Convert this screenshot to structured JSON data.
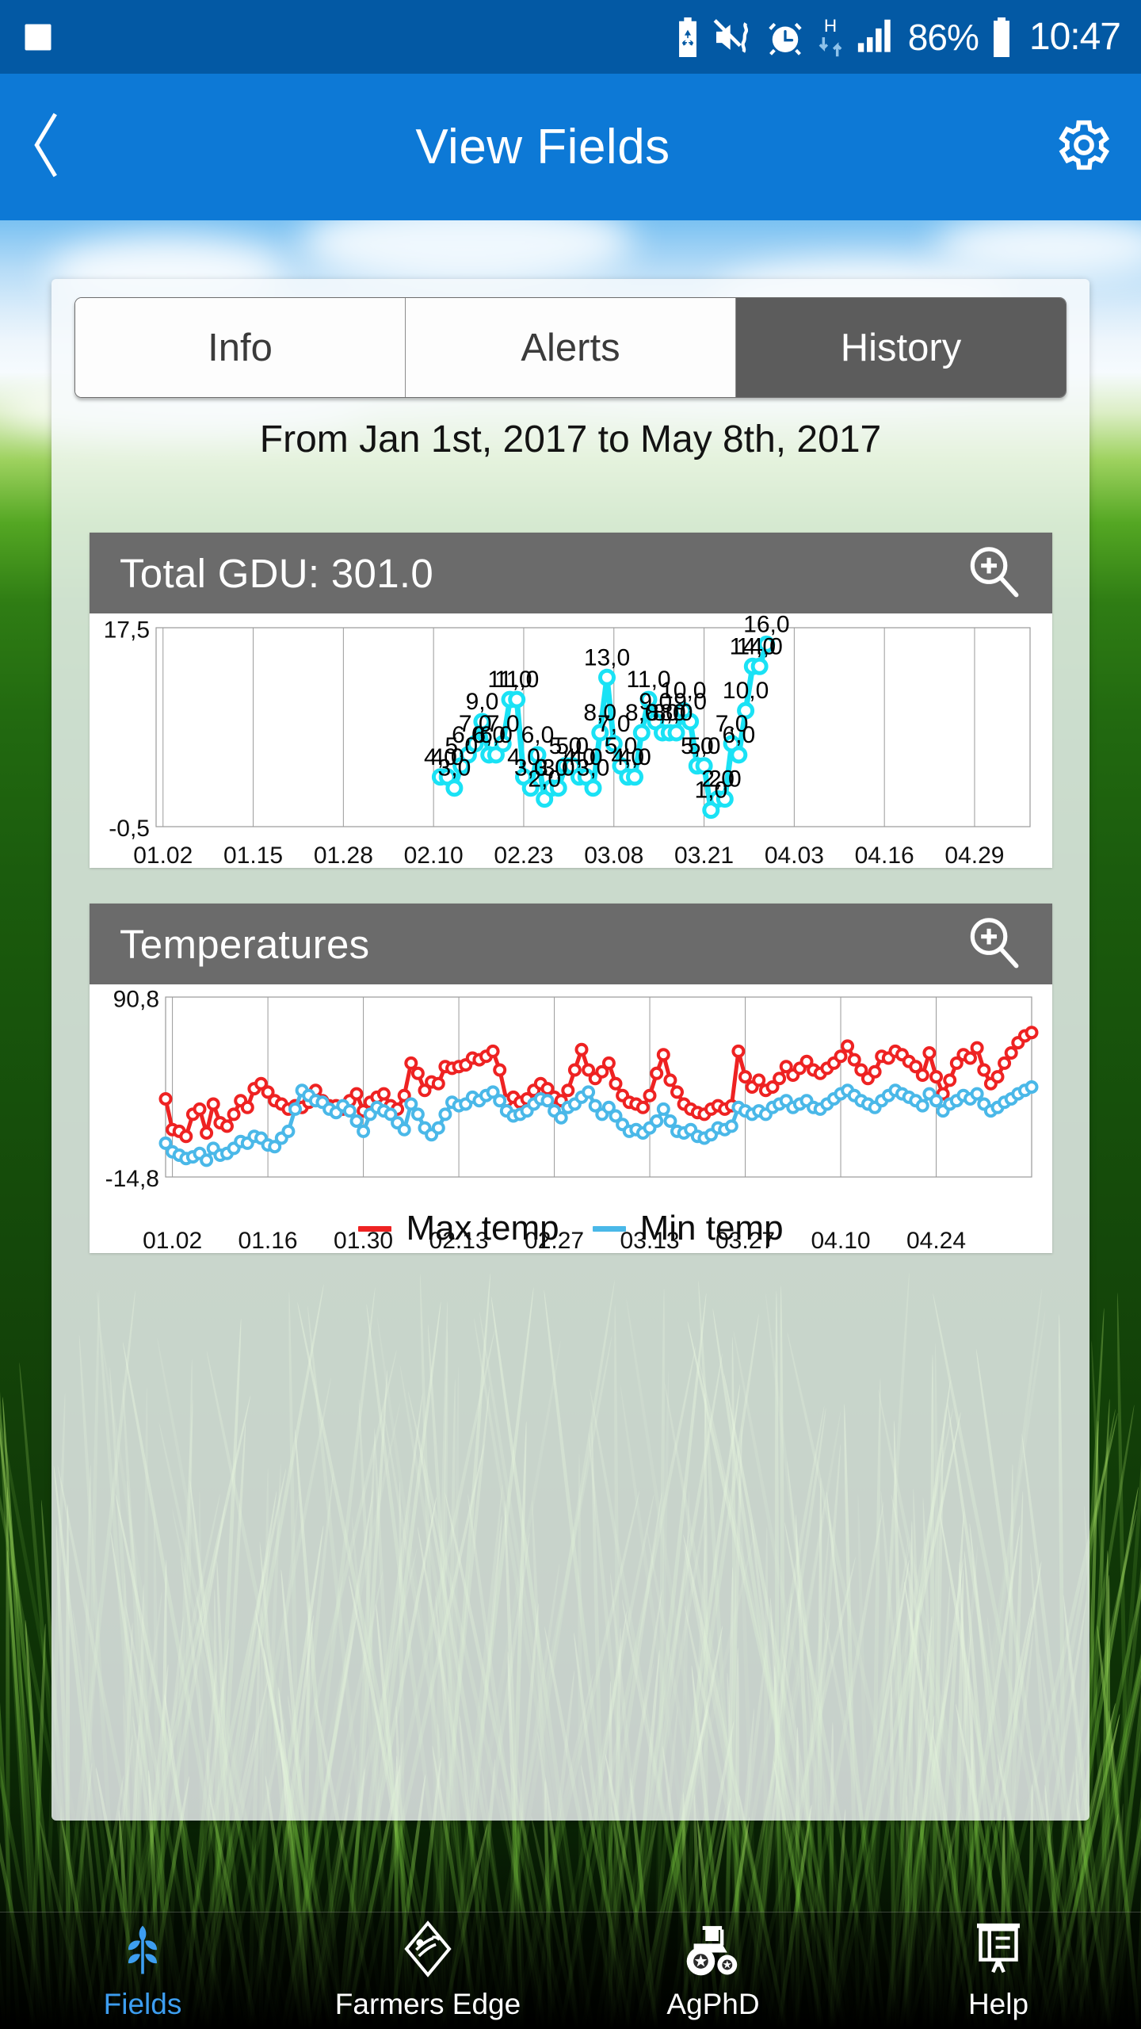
{
  "statusbar": {
    "icons": [
      "gallery-icon",
      "battery-saver-icon",
      "mute-vibrate-icon",
      "alarm-icon",
      "hspa-data-icon",
      "signal-icon"
    ],
    "battery_percent": "86%",
    "clock": "10:47",
    "data_letter": "H"
  },
  "appbar": {
    "back_icon": "back-chevron-icon",
    "title": "View Fields",
    "settings_icon": "gear-icon"
  },
  "tabs": [
    {
      "label": "Info",
      "active": false
    },
    {
      "label": "Alerts",
      "active": false
    },
    {
      "label": "History",
      "active": true
    }
  ],
  "date_range": "From Jan 1st, 2017 to May 8th, 2017",
  "panels": [
    {
      "title": "Total GDU: 301.0",
      "zoom_icon": "zoom-in-icon"
    },
    {
      "title": "Temperatures",
      "zoom_icon": "zoom-in-icon"
    }
  ],
  "colors": {
    "accent": "#0d79d6",
    "statusbar": "#0359a4",
    "panel_header": "#6b6b6b",
    "tab_active": "#5c5c5c",
    "gdu_line": "#1ae2f5",
    "max_temp": "#ee2222",
    "min_temp": "#4ab8e8",
    "nav_active": "#3d9ef0"
  },
  "bottom_nav": [
    {
      "label": "Fields",
      "icon": "wheat-icon",
      "active": true
    },
    {
      "label": "Farmers Edge",
      "icon": "shield-field-icon",
      "active": false
    },
    {
      "label": "AgPhD",
      "icon": "tractor-icon",
      "active": false
    },
    {
      "label": "Help",
      "icon": "presentation-icon",
      "active": false
    }
  ],
  "chart_data": [
    {
      "type": "line",
      "title": "Total GDU: 301.0",
      "xlabel": "",
      "ylabel": "",
      "ylim": [
        -0.5,
        17.5
      ],
      "ytick_labels": [
        "17,5",
        "-0,5"
      ],
      "xtick_labels": [
        "01.02",
        "01.15",
        "01.28",
        "02.10",
        "02.23",
        "03.08",
        "03.21",
        "04.03",
        "04.16",
        "04.29"
      ],
      "grid": true,
      "legend": "none",
      "data_labels": true,
      "series": [
        {
          "name": "GDU",
          "color": "#1ae2f5",
          "x_start_index": 41,
          "total_days": 127,
          "values": [
            4.0,
            4.0,
            3.0,
            5.0,
            6.0,
            7.0,
            9.0,
            6.0,
            6.0,
            7.0,
            11.0,
            11.0,
            4.0,
            3.0,
            6.0,
            2.0,
            3.0,
            3.0,
            5.0,
            5.0,
            4.0,
            4.0,
            3.0,
            8.0,
            13.0,
            7.0,
            5.0,
            4.0,
            4.0,
            8.0,
            11.0,
            9.0,
            8.0,
            8.0,
            8.0,
            10.0,
            9.0,
            5.0,
            5.0,
            1.0,
            2.0,
            2.0,
            7.0,
            6.0,
            10.0,
            14.0,
            14.0,
            16.0
          ]
        }
      ]
    },
    {
      "type": "line",
      "title": "Temperatures",
      "xlabel": "",
      "ylabel": "",
      "ylim": [
        -14.8,
        90.8
      ],
      "ytick_labels": [
        "90,8",
        "-14,8"
      ],
      "xtick_labels": [
        "01.02",
        "01.16",
        "01.30",
        "02.13",
        "02.27",
        "03.13",
        "03.27",
        "04.10",
        "04.24"
      ],
      "grid": true,
      "legend": "bottom",
      "data_labels": false,
      "series": [
        {
          "name": "Max temp",
          "color": "#ee2222",
          "values": [
            31,
            13,
            12,
            9,
            22,
            25,
            11,
            28,
            17,
            15,
            22,
            30,
            26,
            37,
            40,
            35,
            30,
            28,
            25,
            27,
            26,
            29,
            36,
            30,
            27,
            27,
            25,
            30,
            34,
            24,
            29,
            32,
            34,
            27,
            25,
            33,
            52,
            46,
            36,
            41,
            40,
            50,
            49,
            50,
            51,
            55,
            54,
            56,
            59,
            48,
            30,
            32,
            29,
            31,
            36,
            40,
            37,
            32,
            30,
            36,
            48,
            60,
            48,
            43,
            47,
            52,
            40,
            33,
            29,
            28,
            26,
            33,
            46,
            57,
            42,
            35,
            28,
            25,
            23,
            22,
            25,
            27,
            25,
            27,
            59,
            44,
            38,
            42,
            36,
            38,
            43,
            50,
            45,
            49,
            53,
            48,
            46,
            49,
            52,
            56,
            62,
            54,
            48,
            43,
            47,
            56,
            55,
            59,
            57,
            53,
            50,
            45,
            58,
            44,
            34,
            42,
            52,
            57,
            55,
            61,
            48,
            40,
            44,
            52,
            58,
            64,
            68,
            70
          ]
        },
        {
          "name": "Min temp",
          "color": "#4ab8e8",
          "values": [
            5,
            0,
            -2,
            -4,
            -3,
            -1,
            -5,
            2,
            -2,
            -1,
            2,
            6,
            5,
            9,
            8,
            4,
            3,
            8,
            12,
            25,
            36,
            33,
            30,
            29,
            25,
            23,
            27,
            24,
            18,
            12,
            22,
            26,
            24,
            22,
            17,
            13,
            28,
            22,
            14,
            10,
            14,
            22,
            29,
            27,
            28,
            32,
            30,
            33,
            35,
            30,
            24,
            21,
            22,
            24,
            28,
            31,
            30,
            24,
            20,
            26,
            28,
            32,
            35,
            27,
            22,
            26,
            21,
            16,
            12,
            13,
            11,
            14,
            18,
            25,
            18,
            12,
            11,
            13,
            9,
            8,
            10,
            14,
            13,
            15,
            26,
            24,
            22,
            24,
            22,
            26,
            28,
            30,
            26,
            28,
            30,
            26,
            25,
            28,
            31,
            34,
            36,
            33,
            30,
            28,
            26,
            30,
            33,
            36,
            34,
            32,
            30,
            27,
            34,
            30,
            24,
            28,
            30,
            33,
            31,
            34,
            28,
            24,
            26,
            29,
            31,
            34,
            36,
            38
          ]
        }
      ]
    }
  ]
}
